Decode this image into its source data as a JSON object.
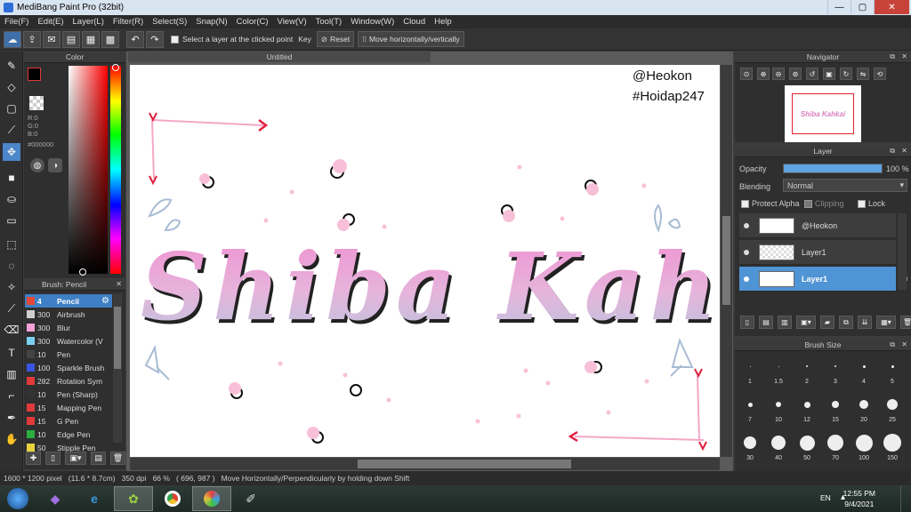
{
  "window": {
    "title": "MediBang Paint Pro (32bit)",
    "minimize": "—",
    "maximize": "▢",
    "close": "✕"
  },
  "menu": [
    "File(F)",
    "Edit(E)",
    "Layer(L)",
    "Filter(R)",
    "Select(S)",
    "Snap(N)",
    "Color(C)",
    "View(V)",
    "Tool(T)",
    "Window(W)",
    "Cloud",
    "Help"
  ],
  "toolbar": {
    "select_layer_label": "Select a layer at the clicked point",
    "key_label": "Key",
    "reset_label": "Reset",
    "move_label": "Move horizontally/vertically"
  },
  "color_panel": {
    "title": "Color",
    "r": "R:0",
    "g": "G:0",
    "b": "B:0",
    "hex": "#000000"
  },
  "brush_panel": {
    "title": "Brush: Pencil",
    "items": [
      {
        "size": "4",
        "name": "Pencil",
        "color": "#e04a3a"
      },
      {
        "size": "300",
        "name": "Airbrush",
        "color": "#cfcfcf"
      },
      {
        "size": "300",
        "name": "Blur",
        "color": "#f5a0d8"
      },
      {
        "size": "300",
        "name": "Watercolor (V",
        "color": "#7ad0f0"
      },
      {
        "size": "10",
        "name": "Pen",
        "color": "#444444"
      },
      {
        "size": "100",
        "name": "Sparkle Brush",
        "color": "#3a55e0"
      },
      {
        "size": "282",
        "name": "Rotation Sym",
        "color": "#e03a3a"
      },
      {
        "size": "10",
        "name": "Pen (Sharp)",
        "color": "#333333"
      },
      {
        "size": "15",
        "name": "Mapping Pen",
        "color": "#e03a3a"
      },
      {
        "size": "15",
        "name": "G Pen",
        "color": "#e03a3a"
      },
      {
        "size": "10",
        "name": "Edge Pen",
        "color": "#2ab040"
      },
      {
        "size": "50",
        "name": "Stipple Pen",
        "color": "#e8d040"
      }
    ]
  },
  "document": {
    "tab": "Untitled",
    "watermark1": "@Heokon",
    "watermark2": "#Hoidap247",
    "artwork_text": "Shiba Kahkai"
  },
  "navigator": {
    "title": "Navigator",
    "thumb_text": "Shiba Kahkai"
  },
  "layer_panel": {
    "title": "Layer",
    "opacity_label": "Opacity",
    "opacity_value": "100 %",
    "opacity": 1.0,
    "blending_label": "Blending",
    "blending_value": "Normal",
    "protect_alpha": "Protect Alpha",
    "clipping": "Clipping",
    "lock": "Lock",
    "layers": [
      {
        "name": "@Heokon"
      },
      {
        "name": "Layer1"
      },
      {
        "name": "Layer1"
      }
    ]
  },
  "brush_size": {
    "title": "Brush Size",
    "sizes": [
      "1",
      "1.5",
      "2",
      "3",
      "4",
      "5",
      "7",
      "10",
      "12",
      "15",
      "20",
      "25",
      "30",
      "40",
      "50",
      "70",
      "100",
      "150"
    ]
  },
  "status": {
    "text": "1600 * 1200 pixel   (11.6 * 8.7cm)   350 dpi   66 %   ( 696, 987 )   Move Horizontally/Perpendicularly by holding down Shift"
  },
  "taskbar": {
    "lang": "EN",
    "time": "12:55 PM",
    "date": "9/4/2021"
  }
}
